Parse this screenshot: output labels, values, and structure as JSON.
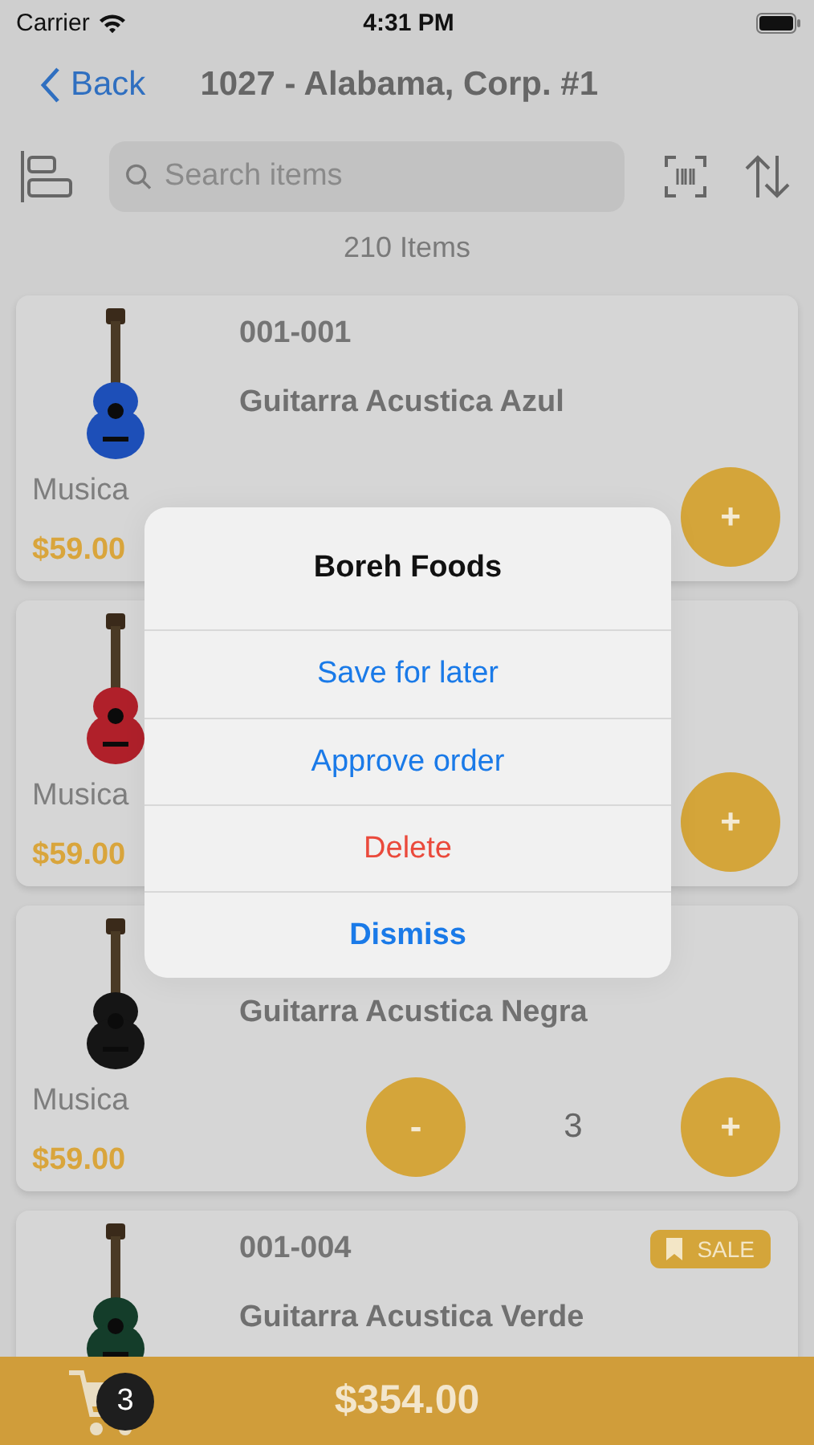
{
  "status_bar": {
    "carrier": "Carrier",
    "time": "4:31 PM"
  },
  "nav": {
    "back": "Back",
    "title": "1027 - Alabama, Corp. #1"
  },
  "search": {
    "placeholder": "Search items"
  },
  "count": "210 Items",
  "items": [
    {
      "code": "001-001",
      "name": "Guitarra Acustica Azul",
      "category": "Musica",
      "price": "$59.00",
      "plus": "+"
    },
    {
      "category": "Musica",
      "price": "$59.00",
      "plus": "+"
    },
    {
      "name": "Guitarra Acustica Negra",
      "category": "Musica",
      "price": "$59.00",
      "minus": "-",
      "quantity": "3",
      "plus": "+"
    },
    {
      "code": "001-004",
      "badge": "SALE",
      "name": "Guitarra Acustica Verde"
    }
  ],
  "alert": {
    "title": "Boreh Foods",
    "actions": [
      {
        "label": "Save for later",
        "kind": "default"
      },
      {
        "label": "Approve order",
        "kind": "default"
      },
      {
        "label": "Delete",
        "kind": "destructive"
      },
      {
        "label": "Dismiss",
        "kind": "cancel"
      }
    ]
  },
  "cart": {
    "count": "3",
    "total": "$354.00"
  }
}
